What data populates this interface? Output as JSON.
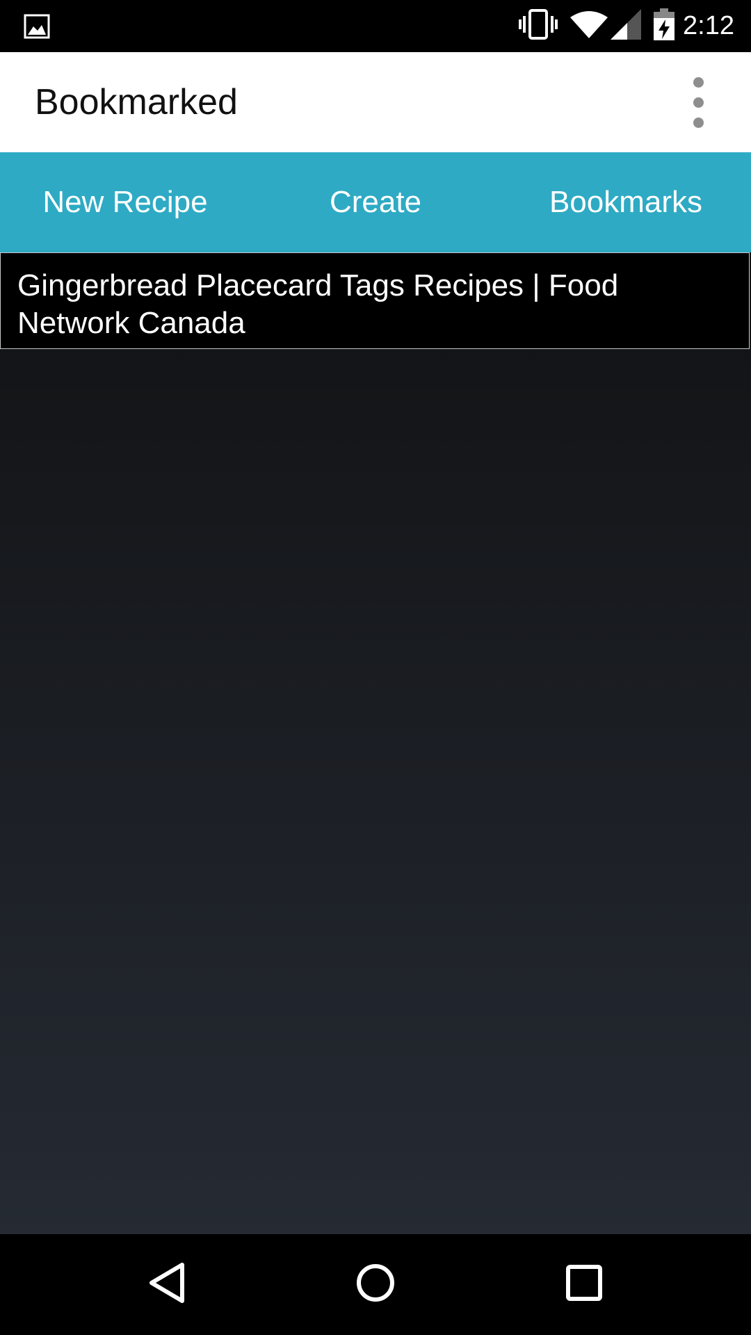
{
  "status_bar": {
    "time": "2:12",
    "icons": [
      "image-icon",
      "vibrate-icon",
      "wifi-icon",
      "signal-icon",
      "battery-charging-icon"
    ]
  },
  "app_bar": {
    "title": "Bookmarked",
    "overflow_icon": "more-vert-icon"
  },
  "tabs": [
    {
      "label": "New Recipe"
    },
    {
      "label": "Create"
    },
    {
      "label": "Bookmarks"
    }
  ],
  "bookmarks": [
    {
      "title": "Gingerbread Placecard Tags Recipes | Food Network Canada"
    }
  ],
  "nav_bar": {
    "icons": [
      "back-icon",
      "home-icon",
      "recents-icon"
    ]
  },
  "colors": {
    "tab_bar": "#2eaac4",
    "app_bar": "#ffffff",
    "content_top": "#111214",
    "content_bottom": "#252a33"
  }
}
